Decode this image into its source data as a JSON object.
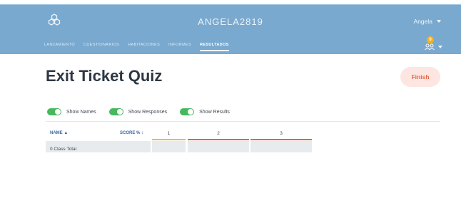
{
  "header": {
    "app_title": "ANGELA2819",
    "user_name": "Angela",
    "notification_count": "0",
    "nav": [
      {
        "label": "LANZAMIENTO"
      },
      {
        "label": "CUESTIONARIOS"
      },
      {
        "label": "HABITACIONES"
      },
      {
        "label": "INFORMES"
      },
      {
        "label": "RESULTADOS"
      }
    ],
    "active_nav": "RESULTADOS"
  },
  "page": {
    "title": "Exit Ticket Quiz",
    "finish_label": "Finish"
  },
  "toggles": [
    {
      "label": "Show Names",
      "on": true
    },
    {
      "label": "Show Responses",
      "on": true
    },
    {
      "label": "Show Results",
      "on": true
    }
  ],
  "table": {
    "col_name": "NAME ▲",
    "col_score": "SCORE % ↕",
    "questions": [
      "1",
      "2",
      "3"
    ],
    "question_colors": [
      "#f0b84a",
      "#e8643f",
      "#e8643f"
    ],
    "rows": [
      {
        "name": "0 Class Total"
      }
    ]
  },
  "colors": {
    "header_bg": "#7aa9cf",
    "toggle_on": "#46b85d",
    "finish_bg": "#fde6e1",
    "finish_text": "#e46a4a"
  }
}
